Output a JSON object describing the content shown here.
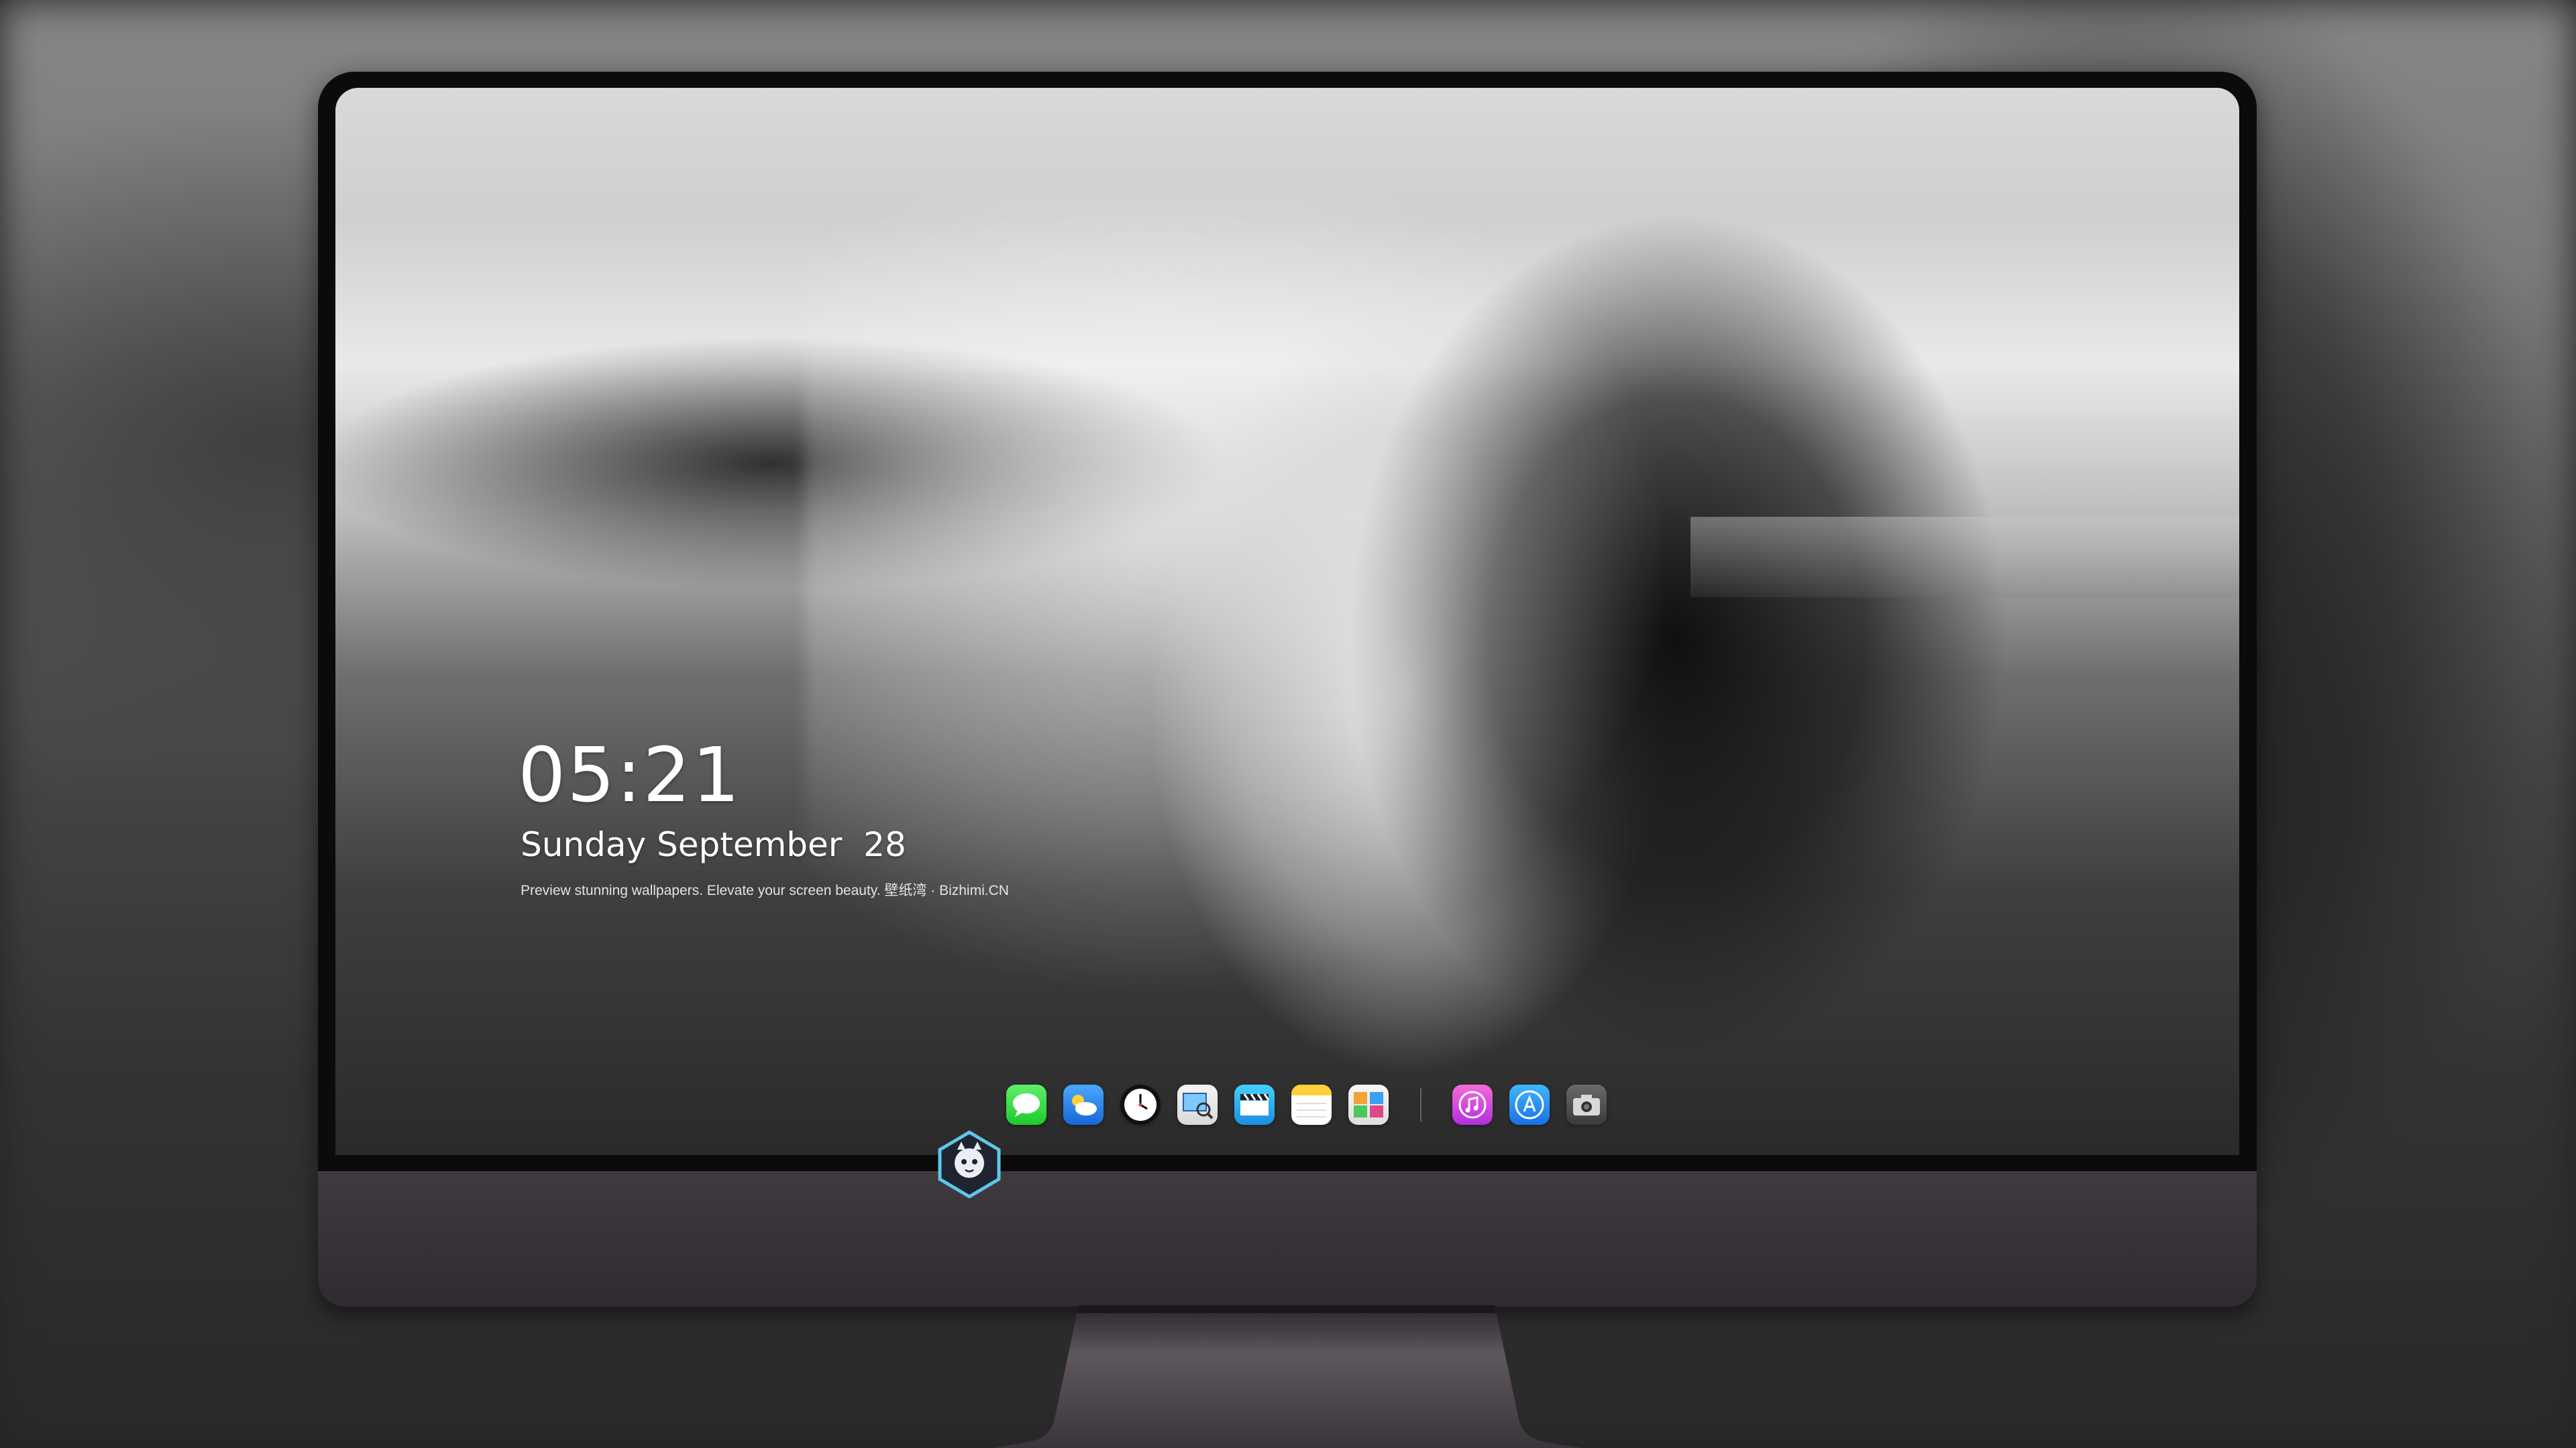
{
  "lockscreen": {
    "time": "05:21",
    "date": "Sunday September  28",
    "tagline": "Preview stunning wallpapers. Elevate your screen beauty. 壁纸湾 · Bizhimi.CN"
  },
  "dock": {
    "apps": [
      {
        "name": "Messages",
        "icon": "messages-icon",
        "color": "#2bd13a"
      },
      {
        "name": "Weather",
        "icon": "weather-icon",
        "color": "#2a86f0"
      },
      {
        "name": "Clock",
        "icon": "clock-icon",
        "color": "#111111"
      },
      {
        "name": "Preview",
        "icon": "preview-icon",
        "color": "#e9e9e9"
      },
      {
        "name": "Clips",
        "icon": "clips-icon",
        "color": "#2fb2f2"
      },
      {
        "name": "Notes",
        "icon": "notes-icon",
        "color": "#ffd54a"
      },
      {
        "name": "Photos",
        "icon": "photos-icon",
        "color": "#e8e8e8"
      },
      {
        "name": "Music",
        "icon": "music-icon",
        "color": "#e04fe0"
      },
      {
        "name": "App Store",
        "icon": "app-store-icon",
        "color": "#2b8cf5"
      },
      {
        "name": "Camera",
        "icon": "camera-icon",
        "color": "#505050"
      }
    ]
  },
  "colors": {
    "bezel": "#0b0b0b",
    "chin": "#3a353a",
    "stand": "#5b555b",
    "logo_border": "#5fc6e8"
  }
}
